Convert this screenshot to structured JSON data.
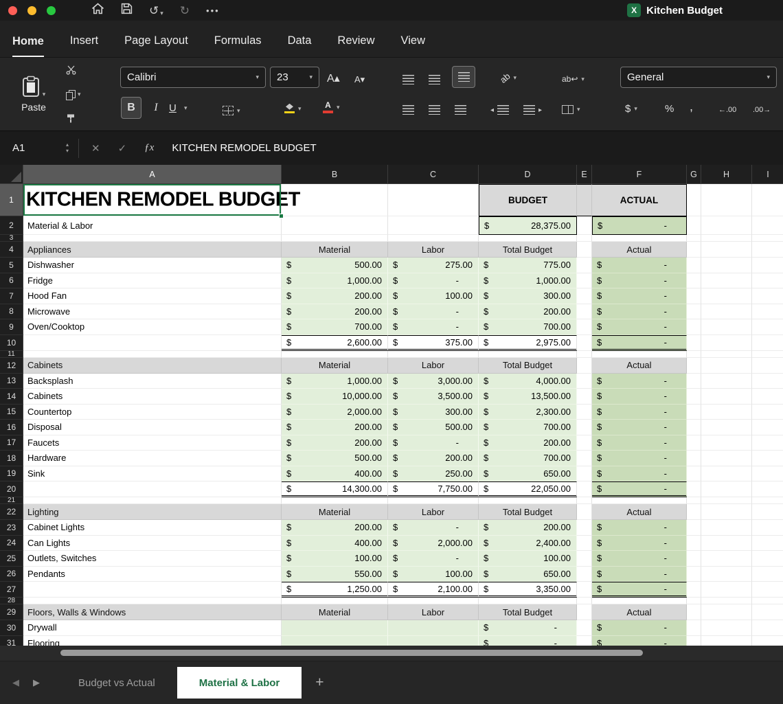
{
  "titlebar": {
    "title": "Kitchen Budget"
  },
  "menu": {
    "tabs": [
      "Home",
      "Insert",
      "Page Layout",
      "Formulas",
      "Data",
      "Review",
      "View"
    ],
    "active": "Home"
  },
  "ribbon": {
    "paste": "Paste",
    "font_name": "Calibri",
    "font_size": "23",
    "number_format": "General"
  },
  "formula_bar": {
    "cell_ref": "A1",
    "value": "KITCHEN REMODEL BUDGET"
  },
  "icons": {
    "chevron": "▾",
    "check": "✓",
    "close": "✕",
    "fx": "ƒx",
    "undo": "↺",
    "redo": "↻",
    "ellipsis": "•••",
    "bold": "B",
    "italic": "I",
    "underline": "U",
    "dollar": "$",
    "percent": "%",
    "comma": ",",
    "grow_font": "A▴",
    "shrink_font": "A▾",
    "increase_decimal": "←.00",
    "decrease_decimal": ".00→",
    "orientation": "ab",
    "wrap": "ab↩",
    "indent_left": "◂",
    "indent_right": "▸",
    "nav_left": "◀",
    "nav_right": "▶",
    "stepper_up": "▴",
    "stepper_down": "▾"
  },
  "grid": {
    "col_letters": [
      "A",
      "B",
      "C",
      "D",
      "E",
      "F",
      "G",
      "H",
      "I"
    ],
    "selected_col": "A",
    "selected_row": 1,
    "selected_cell": "A1"
  },
  "sheet": {
    "title": "KITCHEN REMODEL BUDGET",
    "subtitle": "Material & Labor",
    "budget_header": "BUDGET",
    "actual_header": "ACTUAL",
    "summary": {
      "budget": "28,375.00",
      "actual": "-"
    },
    "sections": [
      {
        "name": "Appliances",
        "cols": [
          "Material",
          "Labor",
          "Total Budget",
          "Actual"
        ],
        "items": [
          {
            "name": "Dishwasher",
            "material": "500.00",
            "labor": "275.00",
            "total": "775.00",
            "actual": "-"
          },
          {
            "name": "Fridge",
            "material": "1,000.00",
            "labor": "-",
            "total": "1,000.00",
            "actual": "-"
          },
          {
            "name": "Hood Fan",
            "material": "200.00",
            "labor": "100.00",
            "total": "300.00",
            "actual": "-"
          },
          {
            "name": "Microwave",
            "material": "200.00",
            "labor": "-",
            "total": "200.00",
            "actual": "-"
          },
          {
            "name": "Oven/Cooktop",
            "material": "700.00",
            "labor": "-",
            "total": "700.00",
            "actual": "-"
          }
        ],
        "total": {
          "material": "2,600.00",
          "labor": "375.00",
          "total": "2,975.00",
          "actual": "-"
        }
      },
      {
        "name": "Cabinets",
        "cols": [
          "Material",
          "Labor",
          "Total Budget",
          "Actual"
        ],
        "items": [
          {
            "name": "Backsplash",
            "material": "1,000.00",
            "labor": "3,000.00",
            "total": "4,000.00",
            "actual": "-"
          },
          {
            "name": "Cabinets",
            "material": "10,000.00",
            "labor": "3,500.00",
            "total": "13,500.00",
            "actual": "-"
          },
          {
            "name": "Countertop",
            "material": "2,000.00",
            "labor": "300.00",
            "total": "2,300.00",
            "actual": "-"
          },
          {
            "name": "Disposal",
            "material": "200.00",
            "labor": "500.00",
            "total": "700.00",
            "actual": "-"
          },
          {
            "name": "Faucets",
            "material": "200.00",
            "labor": "-",
            "total": "200.00",
            "actual": "-"
          },
          {
            "name": "Hardware",
            "material": "500.00",
            "labor": "200.00",
            "total": "700.00",
            "actual": "-"
          },
          {
            "name": "Sink",
            "material": "400.00",
            "labor": "250.00",
            "total": "650.00",
            "actual": "-"
          }
        ],
        "total": {
          "material": "14,300.00",
          "labor": "7,750.00",
          "total": "22,050.00",
          "actual": "-"
        }
      },
      {
        "name": "Lighting",
        "cols": [
          "Material",
          "Labor",
          "Total Budget",
          "Actual"
        ],
        "items": [
          {
            "name": "Cabinet Lights",
            "material": "200.00",
            "labor": "-",
            "total": "200.00",
            "actual": "-"
          },
          {
            "name": "Can Lights",
            "material": "400.00",
            "labor": "2,000.00",
            "total": "2,400.00",
            "actual": "-"
          },
          {
            "name": "Outlets, Switches",
            "material": "100.00",
            "labor": "-",
            "total": "100.00",
            "actual": "-"
          },
          {
            "name": "Pendants",
            "material": "550.00",
            "labor": "100.00",
            "total": "650.00",
            "actual": "-"
          }
        ],
        "total": {
          "material": "1,250.00",
          "labor": "2,100.00",
          "total": "3,350.00",
          "actual": "-"
        }
      },
      {
        "name": "Floors, Walls & Windows",
        "cols": [
          "Material",
          "Labor",
          "Total Budget",
          "Actual"
        ],
        "items": [
          {
            "name": "Drywall",
            "material": "",
            "labor": "",
            "total": "-",
            "actual": "-"
          },
          {
            "name": "Flooring",
            "material": "",
            "labor": "",
            "total": "-",
            "actual": "-"
          }
        ],
        "total": null
      }
    ]
  },
  "sheet_tabs": {
    "tabs": [
      {
        "label": "Budget vs Actual",
        "active": false
      },
      {
        "label": "Material & Labor",
        "active": true
      }
    ],
    "add": "+"
  },
  "colors": {
    "selection_green": "#1b7a44",
    "light_green": "#e2efda",
    "actual_green": "#c9dcb8",
    "section_gray": "#d8d8d8",
    "tab_active_text": "#1e7145"
  }
}
